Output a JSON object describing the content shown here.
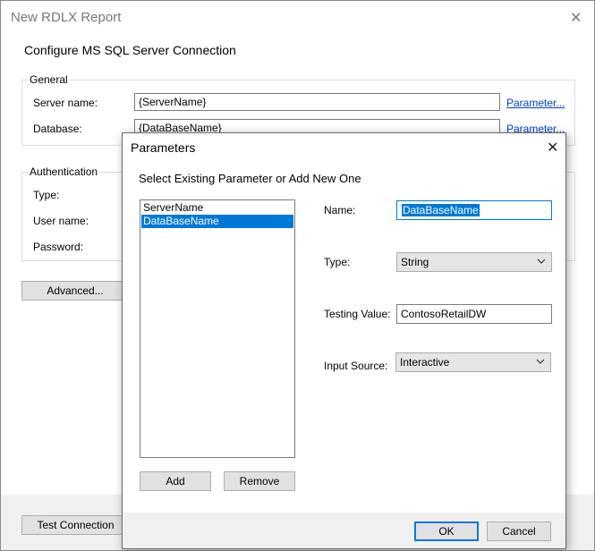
{
  "outer_dialog": {
    "title": "New RDLX Report",
    "heading": "Configure MS SQL Server Connection",
    "general": {
      "legend": "General",
      "server_name_label": "Server name:",
      "server_name_value": "{ServerName}",
      "database_label": "Database:",
      "database_value": "{DataBaseName}",
      "parameter_link": "Parameter..."
    },
    "authentication": {
      "legend": "Authentication",
      "type_label": "Type:",
      "user_name_label": "User name:",
      "password_label": "Password:"
    },
    "advanced_button": "Advanced...",
    "test_connection_button": "Test Connection"
  },
  "parameters_dialog": {
    "title": "Parameters",
    "heading": "Select Existing Parameter or Add New One",
    "list": [
      {
        "label": "ServerName",
        "selected": false
      },
      {
        "label": "DataBaseName",
        "selected": true
      }
    ],
    "add_button": "Add",
    "remove_button": "Remove",
    "name_label": "Name:",
    "name_value": "DataBaseName",
    "type_label": "Type:",
    "type_value": "String",
    "testing_value_label": "Testing Value:",
    "testing_value": "ContosoRetailDW",
    "input_source_label": "Input Source:",
    "input_source_value": "Interactive",
    "ok_button": "OK",
    "cancel_button": "Cancel"
  },
  "colors": {
    "accent": "#0078d7",
    "link": "#0044cc"
  },
  "icons": {
    "close": "close-icon",
    "dropdown": "chevron-down-icon"
  }
}
